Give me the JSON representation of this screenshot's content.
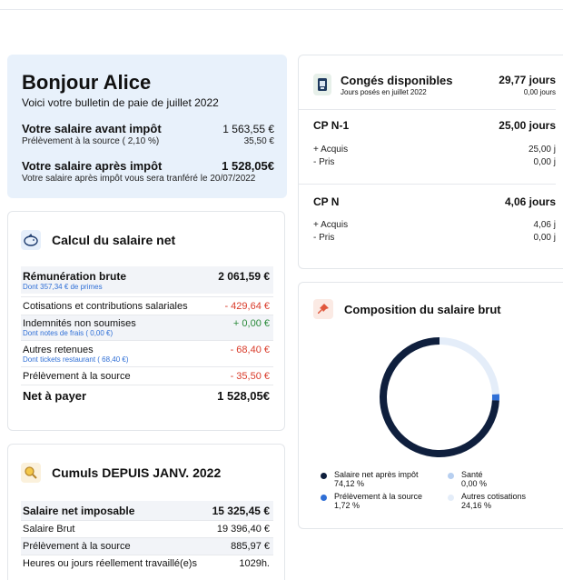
{
  "greeting": {
    "title": "Bonjour Alice",
    "subtitle": "Voici votre bulletin de paie de juillet 2022",
    "before_tax_label": "Votre salaire avant impôt",
    "before_tax_value": "1 563,55 €",
    "withholding_label": "Prélèvement à la source ( 2,10 %)",
    "withholding_value": "35,50 €",
    "after_tax_label": "Votre salaire après impôt",
    "after_tax_value": "1 528,05€",
    "transfer_note": "Votre salaire après impôt vous sera tranféré le 20/07/2022"
  },
  "net_calc": {
    "title": "Calcul du salaire net",
    "icon": "piggy-bank-icon",
    "gross_label": "Rémunération brute",
    "gross_value": "2 061,59 €",
    "gross_note": "Dont 357,34 € de primes",
    "contrib_label": "Cotisations et contributions salariales",
    "contrib_value": "- 429,64 €",
    "indemn_label": "Indemnités non soumises",
    "indemn_value": "+ 0,00 €",
    "indemn_note": "Dont notes de frais ( 0,00 €)",
    "other_label": "Autres retenues",
    "other_value": "- 68,40 €",
    "other_note": "Dont tickets restaurant ( 68,40 €)",
    "withholding_label": "Prélèvement à la source",
    "withholding_value": "- 35,50 €",
    "net_label": "Net à payer",
    "net_value": "1 528,05€"
  },
  "cumuls": {
    "title": "Cumuls DEPUIS JANV. 2022",
    "icon": "magnifier-icon",
    "taxable_label": "Salaire net imposable",
    "taxable_value": "15 325,45 €",
    "gross_label": "Salaire Brut",
    "gross_value": "19 396,40 €",
    "withholding_label": "Prélèvement à la source",
    "withholding_value": "885,97 €",
    "hours_label": "Heures ou jours réellement travaillé(e)s",
    "hours_value": "1029h."
  },
  "leave": {
    "title": "Congés disponibles",
    "subtitle": "Jours posés en juillet 2022",
    "total": "29,77 jours",
    "taken": "0,00 jours",
    "icon": "calendar-icon",
    "cpn1_label": "CP N-1",
    "cpn1_value": "25,00 jours",
    "cpn1_acquired_label": "+ Acquis",
    "cpn1_acquired_value": "25,00 j",
    "cpn1_taken_label": "- Pris",
    "cpn1_taken_value": "0,00 j",
    "cpn_label": "CP N",
    "cpn_value": "4,06 jours",
    "cpn_acquired_label": "+ Acquis",
    "cpn_acquired_value": "4,06 j",
    "cpn_taken_label": "- Pris",
    "cpn_taken_value": "0,00 j"
  },
  "composition": {
    "title": "Composition du salaire brut",
    "icon": "pin-icon",
    "colors": {
      "net": "#0f1f3d",
      "withholding": "#2f6fd6",
      "health": "#b7cff0",
      "other": "#e4edf9"
    },
    "legend": [
      {
        "name": "Salaire net après impôt",
        "pct": "74,12 %"
      },
      {
        "name": "Prélèvement à la source",
        "pct": "1,72 %"
      },
      {
        "name": "Santé",
        "pct": "0,00 %"
      },
      {
        "name": "Autres cotisations",
        "pct": "24,16 %"
      }
    ]
  },
  "chart_data": {
    "type": "pie",
    "categories": [
      "Salaire net après impôt",
      "Prélèvement à la source",
      "Santé",
      "Autres cotisations"
    ],
    "values": [
      74.12,
      1.72,
      0.0,
      24.16
    ]
  }
}
